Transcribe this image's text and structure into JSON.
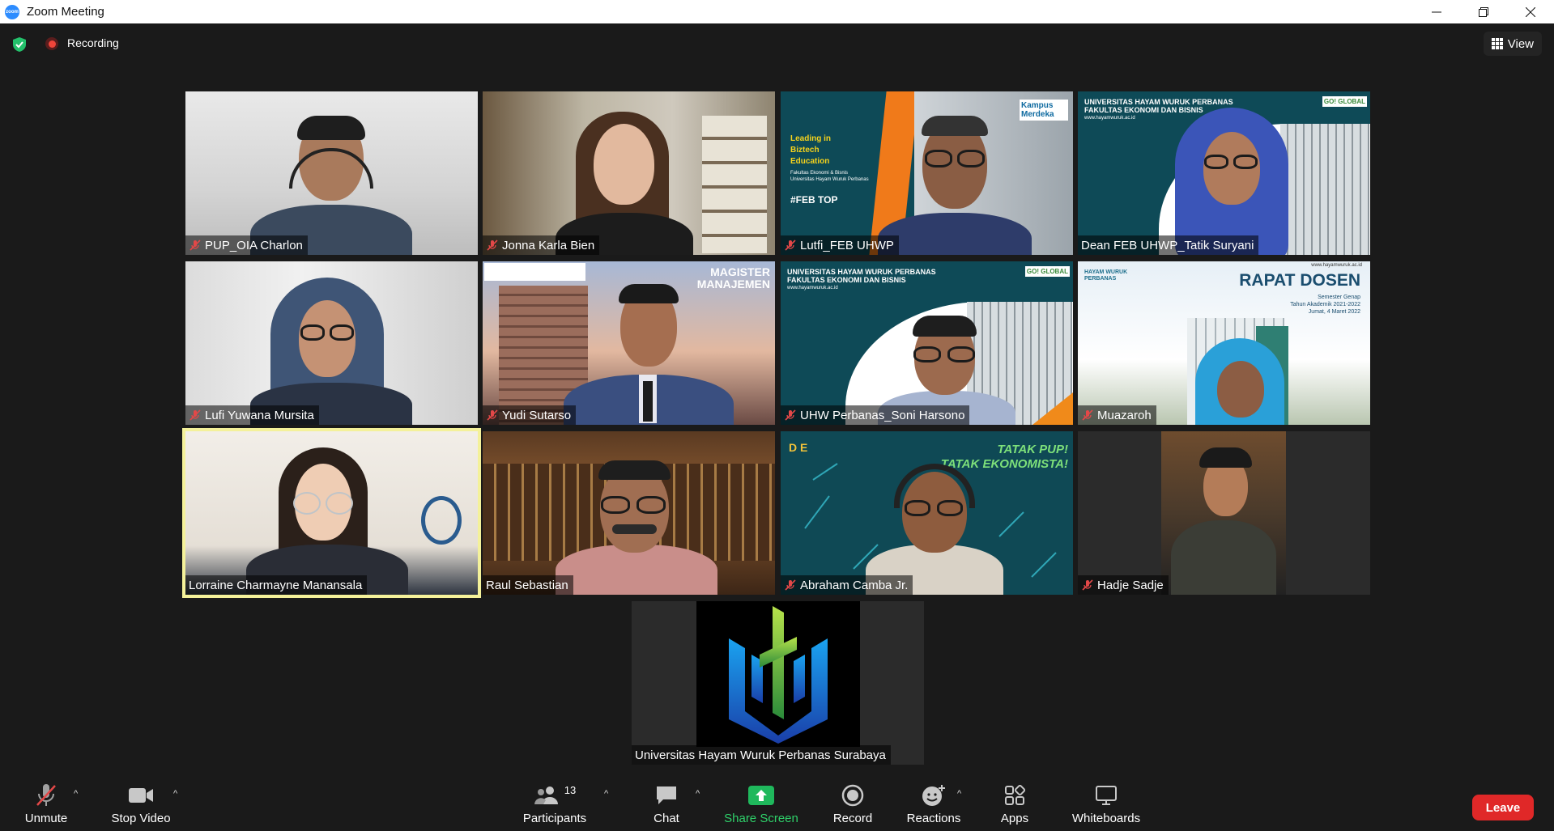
{
  "window": {
    "title": "Zoom Meeting",
    "logo_text": "zoom"
  },
  "topbar": {
    "recording_label": "Recording",
    "view_label": "View"
  },
  "participants": [
    {
      "name": "PUP_OIA Charlon",
      "muted": true
    },
    {
      "name": "Jonna Karla Bien",
      "muted": true
    },
    {
      "name": "Lutfi_FEB UHWP",
      "muted": true
    },
    {
      "name": "Dean FEB UHWP_Tatik Suryani",
      "muted": false
    },
    {
      "name": "Lufi Yuwana Mursita",
      "muted": true
    },
    {
      "name": "Yudi Sutarso",
      "muted": true
    },
    {
      "name": "UHW Perbanas_Soni Harsono",
      "muted": true
    },
    {
      "name": "Muazaroh",
      "muted": true
    },
    {
      "name": "Lorraine Charmayne Manansala",
      "muted": false,
      "active_speaker": true
    },
    {
      "name": "Raul Sebastian",
      "muted": false
    },
    {
      "name": "Abraham Camba Jr.",
      "muted": true
    },
    {
      "name": "Hadje Sadje",
      "muted": true
    },
    {
      "name": "Universitas Hayam Wuruk Perbanas Surabaya",
      "muted": false
    }
  ],
  "backgrounds": {
    "lutfi": {
      "lines": [
        "Leading in",
        "Biztech",
        "Education"
      ],
      "sub": "Fakultas Ekonomi & Bisnis Universitas Hayam Wuruk Perbanas",
      "tag": "#FEB TOP",
      "badge": "Kampus Merdeka"
    },
    "tatik": {
      "header": "UNIVERSITAS HAYAM WURUK PERBANAS",
      "sub": "FAKULTAS EKONOMI DAN BISNIS",
      "url": "www.hayamwuruk.ac.id",
      "badge": "GO! GLOBAL"
    },
    "yudi": {
      "title_line1": "MAGISTER",
      "title_line2": "MANAJEMEN"
    },
    "soni": {
      "header": "UNIVERSITAS HAYAM WURUK PERBANAS",
      "sub": "FAKULTAS EKONOMI DAN BISNIS",
      "url": "www.hayamwuruk.ac.id",
      "badge": "GO! GLOBAL"
    },
    "muazaroh": {
      "title": "RAPAT DOSEN",
      "url": "www.hayamwuruk.ac.id",
      "line1": "Semester Genap",
      "line2": "Tahun Akademik 2021-2022",
      "line3": "Jumat, 4 Maret 2022",
      "logo_text": "HAYAM WURUK PERBANAS"
    },
    "abraham": {
      "slogan1": "TATAK PUP!",
      "slogan2": "TATAK EKONOMISTA!",
      "badge": "D E"
    }
  },
  "toolbar": {
    "unmute": "Unmute",
    "stop_video": "Stop Video",
    "participants": "Participants",
    "participants_count": "13",
    "chat": "Chat",
    "share_screen": "Share Screen",
    "record": "Record",
    "reactions": "Reactions",
    "apps": "Apps",
    "whiteboards": "Whiteboards",
    "leave": "Leave"
  },
  "colors": {
    "active_speaker": "#f4f19a",
    "share_green": "#2fd16a",
    "leave_red": "#e02828",
    "recording_red": "#f0453a",
    "background": "#1a1a1a"
  }
}
